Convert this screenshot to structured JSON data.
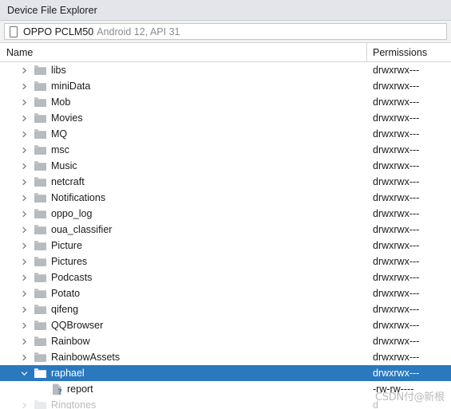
{
  "window": {
    "title": "Device File Explorer"
  },
  "device": {
    "icon": "phone-icon",
    "name": "OPPO PCLM50",
    "details": "Android 12, API 31"
  },
  "columns": {
    "name": "Name",
    "permissions": "Permissions"
  },
  "watermark": {
    "text": "CSDN付@新根"
  },
  "tree": {
    "rows": [
      {
        "label": "libs",
        "permissions": "drwxrwx---",
        "type": "folder",
        "expandable": true,
        "expanded": false,
        "selected": false,
        "depth": 0
      },
      {
        "label": "miniData",
        "permissions": "drwxrwx---",
        "type": "folder",
        "expandable": true,
        "expanded": false,
        "selected": false,
        "depth": 0
      },
      {
        "label": "Mob",
        "permissions": "drwxrwx---",
        "type": "folder",
        "expandable": true,
        "expanded": false,
        "selected": false,
        "depth": 0
      },
      {
        "label": "Movies",
        "permissions": "drwxrwx---",
        "type": "folder",
        "expandable": true,
        "expanded": false,
        "selected": false,
        "depth": 0
      },
      {
        "label": "MQ",
        "permissions": "drwxrwx---",
        "type": "folder",
        "expandable": true,
        "expanded": false,
        "selected": false,
        "depth": 0
      },
      {
        "label": "msc",
        "permissions": "drwxrwx---",
        "type": "folder",
        "expandable": true,
        "expanded": false,
        "selected": false,
        "depth": 0
      },
      {
        "label": "Music",
        "permissions": "drwxrwx---",
        "type": "folder",
        "expandable": true,
        "expanded": false,
        "selected": false,
        "depth": 0
      },
      {
        "label": "netcraft",
        "permissions": "drwxrwx---",
        "type": "folder",
        "expandable": true,
        "expanded": false,
        "selected": false,
        "depth": 0
      },
      {
        "label": "Notifications",
        "permissions": "drwxrwx---",
        "type": "folder",
        "expandable": true,
        "expanded": false,
        "selected": false,
        "depth": 0
      },
      {
        "label": "oppo_log",
        "permissions": "drwxrwx---",
        "type": "folder",
        "expandable": true,
        "expanded": false,
        "selected": false,
        "depth": 0
      },
      {
        "label": "oua_classifier",
        "permissions": "drwxrwx---",
        "type": "folder",
        "expandable": true,
        "expanded": false,
        "selected": false,
        "depth": 0
      },
      {
        "label": "Picture",
        "permissions": "drwxrwx---",
        "type": "folder",
        "expandable": true,
        "expanded": false,
        "selected": false,
        "depth": 0
      },
      {
        "label": "Pictures",
        "permissions": "drwxrwx---",
        "type": "folder",
        "expandable": true,
        "expanded": false,
        "selected": false,
        "depth": 0
      },
      {
        "label": "Podcasts",
        "permissions": "drwxrwx---",
        "type": "folder",
        "expandable": true,
        "expanded": false,
        "selected": false,
        "depth": 0
      },
      {
        "label": "Potato",
        "permissions": "drwxrwx---",
        "type": "folder",
        "expandable": true,
        "expanded": false,
        "selected": false,
        "depth": 0
      },
      {
        "label": "qifeng",
        "permissions": "drwxrwx---",
        "type": "folder",
        "expandable": true,
        "expanded": false,
        "selected": false,
        "depth": 0
      },
      {
        "label": "QQBrowser",
        "permissions": "drwxrwx---",
        "type": "folder",
        "expandable": true,
        "expanded": false,
        "selected": false,
        "depth": 0
      },
      {
        "label": "Rainbow",
        "permissions": "drwxrwx---",
        "type": "folder",
        "expandable": true,
        "expanded": false,
        "selected": false,
        "depth": 0
      },
      {
        "label": "RainbowAssets",
        "permissions": "drwxrwx---",
        "type": "folder",
        "expandable": true,
        "expanded": false,
        "selected": false,
        "depth": 0
      },
      {
        "label": "raphael",
        "permissions": "drwxrwx---",
        "type": "folder",
        "expandable": true,
        "expanded": true,
        "selected": true,
        "depth": 0
      },
      {
        "label": "report",
        "permissions": "-rw-rw----",
        "type": "file",
        "expandable": false,
        "expanded": false,
        "selected": false,
        "depth": 1
      },
      {
        "label": "Ringtones",
        "permissions": "d",
        "type": "folder",
        "expandable": true,
        "expanded": false,
        "selected": false,
        "depth": 0,
        "clipped": true
      }
    ]
  }
}
